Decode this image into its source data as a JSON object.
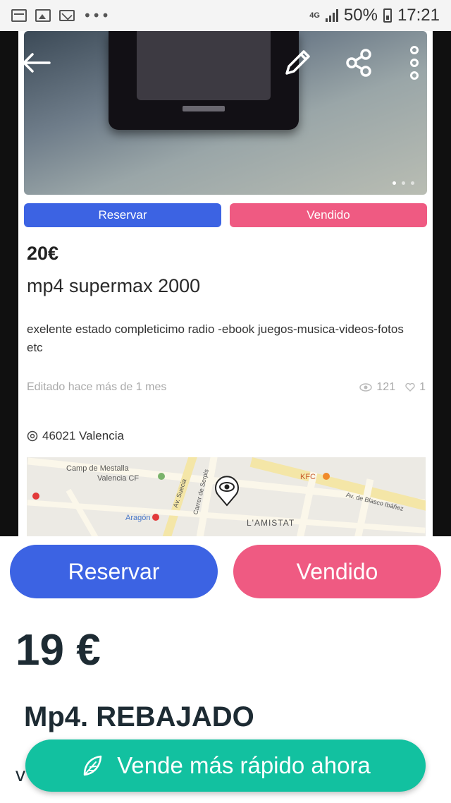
{
  "status_bar": {
    "network": "4G",
    "battery": "50%",
    "time": "17:21"
  },
  "inner_listing": {
    "reserve_label": "Reservar",
    "sold_label": "Vendido",
    "price": "20€",
    "title": "mp4 supermax 2000",
    "description": "exelente estado completicimo radio -ebook juegos-musica-videos-fotos etc",
    "edited": "Editado hace más de 1 mes",
    "views": "121",
    "favorites": "1",
    "location": "46021 Valencia",
    "map_labels": {
      "stadium": "Camp de Mestalla",
      "stadium_line2": "Valencia CF",
      "aragon": "Aragón",
      "kfc": "KFC",
      "neighborhood": "L'AMISTAT",
      "street1": "Av. Suecia",
      "street2": "Carrer de Serpis",
      "street3": "Av. de Blasco Ibáñez"
    }
  },
  "main": {
    "reserve_label": "Reservar",
    "sold_label": "Vendido",
    "price": "19 €",
    "title": "Mp4. REBAJADO",
    "desc_start": "v"
  },
  "fab": {
    "label": "Vende más rápido ahora",
    "icon": "feather-icon",
    "color": "#12c1a0"
  },
  "colors": {
    "reserve": "#3c63e3",
    "sold": "#ef5a82"
  }
}
